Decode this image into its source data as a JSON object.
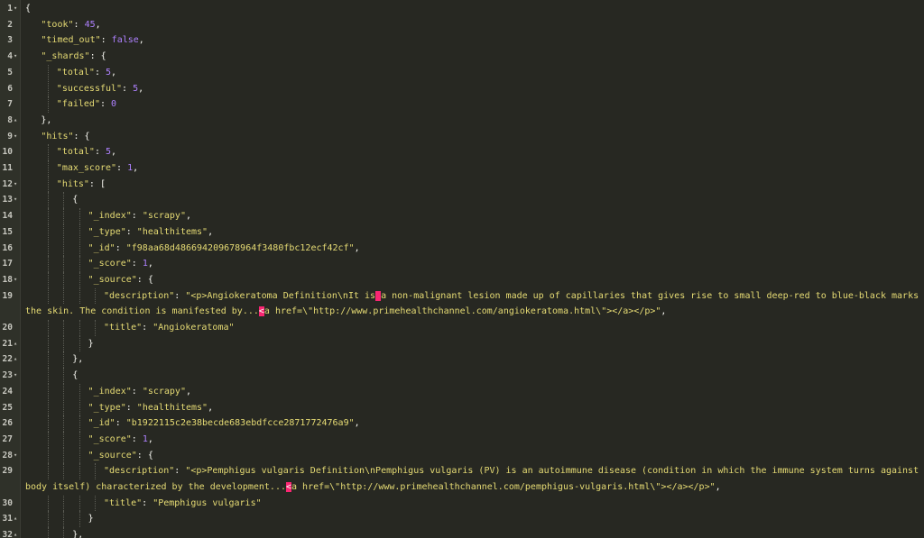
{
  "editor": {
    "lines": [
      {
        "n": "1",
        "fold": "▾",
        "indent": 0,
        "parts": [
          [
            "p",
            "{"
          ]
        ]
      },
      {
        "n": "2",
        "fold": "",
        "indent": 1,
        "parts": [
          [
            "k",
            "\"took\""
          ],
          [
            "p",
            ": "
          ],
          [
            "n",
            "45"
          ],
          [
            "p",
            ","
          ]
        ]
      },
      {
        "n": "3",
        "fold": "",
        "indent": 1,
        "parts": [
          [
            "k",
            "\"timed_out\""
          ],
          [
            "p",
            ": "
          ],
          [
            "n",
            "false"
          ],
          [
            "p",
            ","
          ]
        ]
      },
      {
        "n": "4",
        "fold": "▾",
        "indent": 1,
        "parts": [
          [
            "k",
            "\"_shards\""
          ],
          [
            "p",
            ": {"
          ]
        ]
      },
      {
        "n": "5",
        "fold": "",
        "indent": 2,
        "parts": [
          [
            "k",
            "\"total\""
          ],
          [
            "p",
            ": "
          ],
          [
            "n",
            "5"
          ],
          [
            "p",
            ","
          ]
        ]
      },
      {
        "n": "6",
        "fold": "",
        "indent": 2,
        "parts": [
          [
            "k",
            "\"successful\""
          ],
          [
            "p",
            ": "
          ],
          [
            "n",
            "5"
          ],
          [
            "p",
            ","
          ]
        ]
      },
      {
        "n": "7",
        "fold": "",
        "indent": 2,
        "parts": [
          [
            "k",
            "\"failed\""
          ],
          [
            "p",
            ": "
          ],
          [
            "n",
            "0"
          ]
        ]
      },
      {
        "n": "8",
        "fold": "▴",
        "indent": 1,
        "parts": [
          [
            "p",
            "},"
          ]
        ]
      },
      {
        "n": "9",
        "fold": "▾",
        "indent": 1,
        "parts": [
          [
            "k",
            "\"hits\""
          ],
          [
            "p",
            ": {"
          ]
        ]
      },
      {
        "n": "10",
        "fold": "",
        "indent": 2,
        "parts": [
          [
            "k",
            "\"total\""
          ],
          [
            "p",
            ": "
          ],
          [
            "n",
            "5"
          ],
          [
            "p",
            ","
          ]
        ]
      },
      {
        "n": "11",
        "fold": "",
        "indent": 2,
        "parts": [
          [
            "k",
            "\"max_score\""
          ],
          [
            "p",
            ": "
          ],
          [
            "n",
            "1"
          ],
          [
            "p",
            ","
          ]
        ]
      },
      {
        "n": "12",
        "fold": "▾",
        "indent": 2,
        "parts": [
          [
            "k",
            "\"hits\""
          ],
          [
            "p",
            ": ["
          ]
        ]
      },
      {
        "n": "13",
        "fold": "▾",
        "indent": 3,
        "parts": [
          [
            "p",
            "{"
          ]
        ]
      },
      {
        "n": "14",
        "fold": "",
        "indent": 4,
        "parts": [
          [
            "k",
            "\"_index\""
          ],
          [
            "p",
            ": "
          ],
          [
            "s",
            "\"scrapy\""
          ],
          [
            "p",
            ","
          ]
        ]
      },
      {
        "n": "15",
        "fold": "",
        "indent": 4,
        "parts": [
          [
            "k",
            "\"_type\""
          ],
          [
            "p",
            ": "
          ],
          [
            "s",
            "\"healthitems\""
          ],
          [
            "p",
            ","
          ]
        ]
      },
      {
        "n": "16",
        "fold": "",
        "indent": 4,
        "parts": [
          [
            "k",
            "\"_id\""
          ],
          [
            "p",
            ": "
          ],
          [
            "s",
            "\"f98aa68d486694209678964f3480fbc12ecf42cf\""
          ],
          [
            "p",
            ","
          ]
        ]
      },
      {
        "n": "17",
        "fold": "",
        "indent": 4,
        "parts": [
          [
            "k",
            "\"_score\""
          ],
          [
            "p",
            ": "
          ],
          [
            "n",
            "1"
          ],
          [
            "p",
            ","
          ]
        ]
      },
      {
        "n": "18",
        "fold": "▾",
        "indent": 4,
        "parts": [
          [
            "k",
            "\"_source\""
          ],
          [
            "p",
            ": {"
          ]
        ]
      },
      {
        "n": "19",
        "fold": "",
        "indent": 5,
        "parts": [
          [
            "k",
            "\"description\""
          ],
          [
            "p",
            ": "
          ],
          [
            "s",
            "\"<p>Angiokeratoma Definition\\nIt is"
          ],
          [
            "hl",
            " "
          ],
          [
            "s",
            "a non-malignant lesion made up of capillaries that gives rise to small deep-red to blue-black marks on"
          ]
        ],
        "cont": [
          [
            "s",
            "the skin. The condition is manifested by..."
          ],
          [
            "hl",
            "<"
          ],
          [
            "s",
            "a href=\\\"http://www.primehealthchannel.com/angiokeratoma.html\\\">"
          ],
          [
            "s",
            "</a></p>\""
          ],
          [
            "p",
            ","
          ]
        ]
      },
      {
        "n": "20",
        "fold": "",
        "indent": 5,
        "parts": [
          [
            "k",
            "\"title\""
          ],
          [
            "p",
            ": "
          ],
          [
            "s",
            "\"Angiokeratoma\""
          ]
        ]
      },
      {
        "n": "21",
        "fold": "▴",
        "indent": 4,
        "parts": [
          [
            "p",
            "}"
          ]
        ]
      },
      {
        "n": "22",
        "fold": "▴",
        "indent": 3,
        "parts": [
          [
            "p",
            "},"
          ]
        ]
      },
      {
        "n": "23",
        "fold": "▾",
        "indent": 3,
        "parts": [
          [
            "p",
            "{"
          ]
        ]
      },
      {
        "n": "24",
        "fold": "",
        "indent": 4,
        "parts": [
          [
            "k",
            "\"_index\""
          ],
          [
            "p",
            ": "
          ],
          [
            "s",
            "\"scrapy\""
          ],
          [
            "p",
            ","
          ]
        ]
      },
      {
        "n": "25",
        "fold": "",
        "indent": 4,
        "parts": [
          [
            "k",
            "\"_type\""
          ],
          [
            "p",
            ": "
          ],
          [
            "s",
            "\"healthitems\""
          ],
          [
            "p",
            ","
          ]
        ]
      },
      {
        "n": "26",
        "fold": "",
        "indent": 4,
        "parts": [
          [
            "k",
            "\"_id\""
          ],
          [
            "p",
            ": "
          ],
          [
            "s",
            "\"b1922115c2e38becde683ebdfcce2871772476a9\""
          ],
          [
            "p",
            ","
          ]
        ]
      },
      {
        "n": "27",
        "fold": "",
        "indent": 4,
        "parts": [
          [
            "k",
            "\"_score\""
          ],
          [
            "p",
            ": "
          ],
          [
            "n",
            "1"
          ],
          [
            "p",
            ","
          ]
        ]
      },
      {
        "n": "28",
        "fold": "▾",
        "indent": 4,
        "parts": [
          [
            "k",
            "\"_source\""
          ],
          [
            "p",
            ": {"
          ]
        ]
      },
      {
        "n": "29",
        "fold": "",
        "indent": 5,
        "parts": [
          [
            "k",
            "\"description\""
          ],
          [
            "p",
            ": "
          ],
          [
            "s",
            "\"<p>Pemphigus vulgaris Definition\\nPemphigus vulgaris (PV) is an autoimmune disease (condition in which the immune system turns against the"
          ]
        ],
        "cont": [
          [
            "s",
            "body itself) characterized by the development..."
          ],
          [
            "hl",
            "<"
          ],
          [
            "s",
            "a href=\\\"http://www.primehealthchannel.com/pemphigus-vulgaris.html\\\">"
          ],
          [
            "s",
            "</a></p>\""
          ],
          [
            "p",
            ","
          ]
        ]
      },
      {
        "n": "30",
        "fold": "",
        "indent": 5,
        "parts": [
          [
            "k",
            "\"title\""
          ],
          [
            "p",
            ": "
          ],
          [
            "s",
            "\"Pemphigus vulgaris\""
          ]
        ]
      },
      {
        "n": "31",
        "fold": "▴",
        "indent": 4,
        "parts": [
          [
            "p",
            "}"
          ]
        ]
      },
      {
        "n": "32",
        "fold": "▴",
        "indent": 3,
        "parts": [
          [
            "p",
            "},"
          ]
        ]
      }
    ]
  }
}
